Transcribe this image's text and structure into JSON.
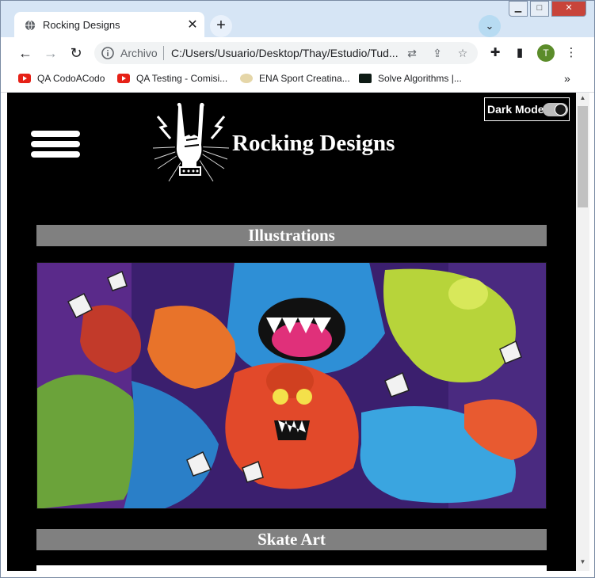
{
  "browser": {
    "tab_title": "Rocking Designs",
    "tab_close": "✕",
    "new_tab": "+",
    "url_scheme": "Archivo",
    "url": "C:/Users/Usuario/Desktop/Thay/Estudio/Tud...",
    "profile_initial": "T",
    "bookmarks": [
      {
        "label": "QA CodoACodo",
        "icon": "youtube-icon"
      },
      {
        "label": "QA Testing - Comisi...",
        "icon": "youtube-icon"
      },
      {
        "label": "ENA Sport Creatina...",
        "icon": "ena-icon"
      },
      {
        "label": "Solve Algorithms |...",
        "icon": "hackerrank-icon"
      }
    ],
    "bookmarks_more": "»"
  },
  "page": {
    "site_title": "Rocking Designs",
    "dark_mode_label": "Dark Mode",
    "dark_mode_on": true,
    "sections": [
      {
        "title": "Illustrations"
      },
      {
        "title": "Skate Art"
      }
    ]
  },
  "colors": {
    "page_bg": "#000000",
    "section_bar": "#808080",
    "text": "#ffffff"
  }
}
